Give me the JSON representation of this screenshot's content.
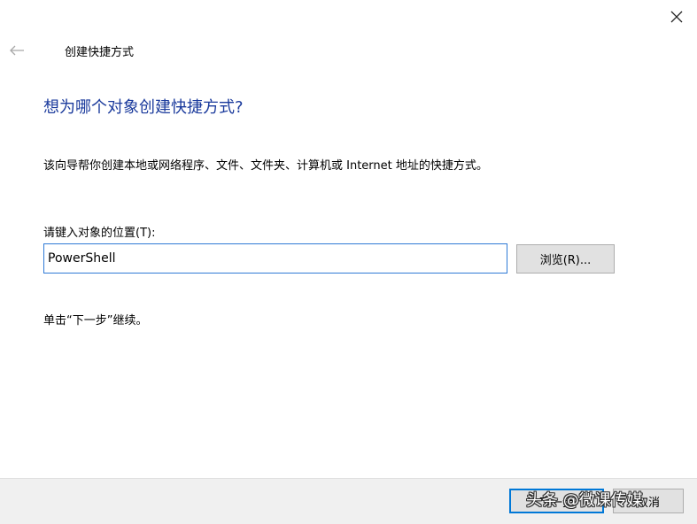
{
  "window": {
    "close_icon": "close-icon",
    "back_icon": "back-arrow-icon"
  },
  "wizard": {
    "title": "创建快捷方式",
    "heading": "想为哪个对象创建快捷方式?",
    "description": "该向导帮你创建本地或网络程序、文件、文件夹、计算机或 Internet 地址的快捷方式。",
    "location_label": "请键入对象的位置(T):",
    "location_value": "PowerShell",
    "browse_label": "浏览(R)...",
    "continue_hint": "单击“下一步”继续。"
  },
  "footer": {
    "next_label": "下一步",
    "cancel_label": "取消"
  },
  "watermark": {
    "text": "头条 @微课传媒"
  },
  "colors": {
    "heading": "#1a3a9c",
    "input_focus_border": "#2f7ad6",
    "default_button_border": "#0078d7",
    "footer_bg": "#f0f0f0"
  }
}
